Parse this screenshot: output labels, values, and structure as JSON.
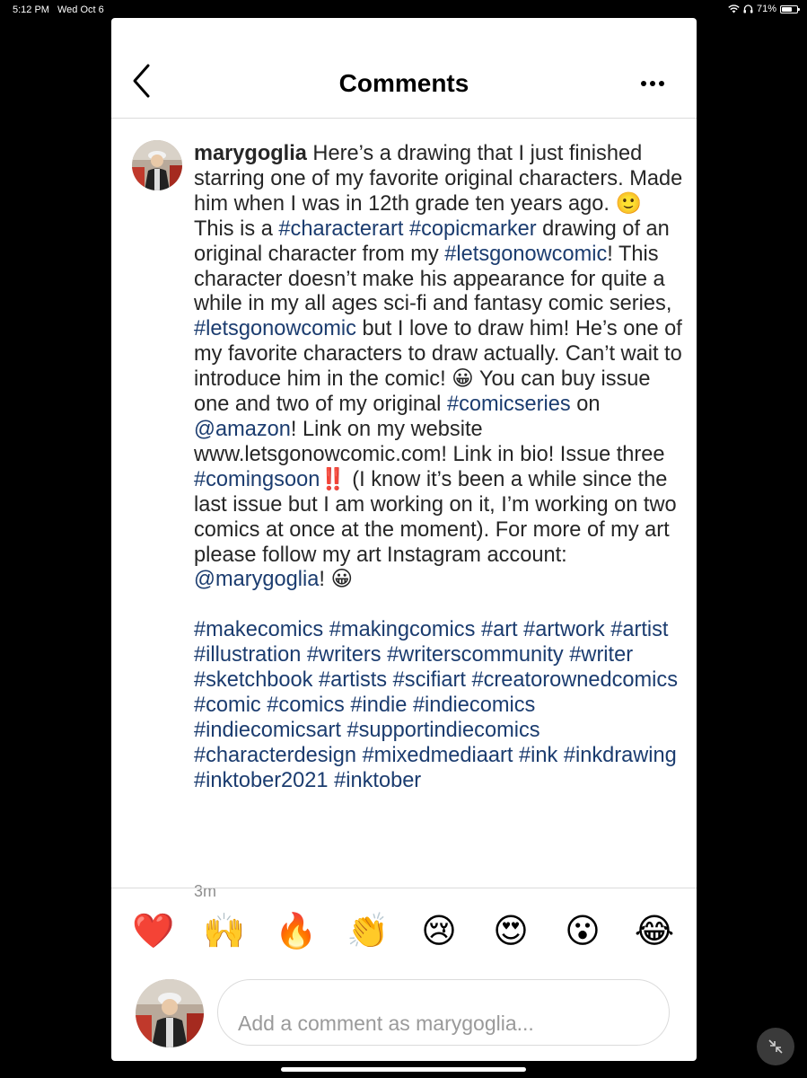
{
  "status": {
    "time": "5:12 PM",
    "date": "Wed Oct 6",
    "battery": "71%",
    "battery_level": 0.71
  },
  "header": {
    "title": "Comments"
  },
  "caption": {
    "username": "marygoglia",
    "p1": [
      {
        "t": "text",
        "v": " Here’s a drawing that I just finished starring one of my favorite original characters. Made him when I was in 12th grade ten years ago. 🙂 This is a "
      },
      {
        "t": "tag",
        "v": "#characterart"
      },
      {
        "t": "text",
        "v": " "
      },
      {
        "t": "tag",
        "v": "#copicmarker"
      },
      {
        "t": "text",
        "v": " drawing of an original character from my "
      },
      {
        "t": "tag",
        "v": "#letsgonowcomic"
      },
      {
        "t": "text",
        "v": "! This character doesn’t make his appearance for quite a while in my all ages sci-fi and fantasy comic series, "
      },
      {
        "t": "tag",
        "v": "#letsgonowcomic"
      },
      {
        "t": "text",
        "v": " but I love to draw him! He’s one of my favorite characters to draw actually. Can’t wait to introduce him in the comic! 😀 You can buy issue one and two of my original "
      },
      {
        "t": "tag",
        "v": "#comicseries"
      },
      {
        "t": "text",
        "v": " on "
      },
      {
        "t": "mention",
        "v": "@amazon"
      },
      {
        "t": "text",
        "v": "! Link on my website www.letsgonowcomic.com! Link in bio! Issue three "
      },
      {
        "t": "tag",
        "v": "#comingsoon"
      },
      {
        "t": "text",
        "v": "‼️ (I know it’s been a while since the last issue but I am working on it, I’m working on two comics at once at the moment). For more of my art please follow my art Instagram account: "
      },
      {
        "t": "mention",
        "v": "@marygoglia"
      },
      {
        "t": "text",
        "v": "! 😀"
      }
    ],
    "hashtags": [
      "#makecomics",
      "#makingcomics",
      "#art",
      "#artwork",
      "#artist",
      "#illustration",
      "#writers",
      "#writerscommunity",
      "#writer",
      "#sketchbook",
      "#artists",
      "#scifiart",
      "#creatorownedcomics",
      "#comic",
      "#comics",
      "#indie",
      "#indiecomics",
      "#indiecomicsart",
      "#supportindiecomics",
      "#characterdesign",
      "#mixedmediaart",
      "#ink",
      "#inkdrawing",
      "#inktober2021",
      "#inktober"
    ],
    "time_ago": "3m"
  },
  "reactions": [
    "❤️",
    "🙌",
    "🔥",
    "👏",
    "😢",
    "😍",
    "😮",
    "😂"
  ],
  "comment_box": {
    "placeholder": "Add a comment as marygoglia..."
  },
  "icons": {
    "back": "chevron-left-icon",
    "more": "more-horizontal-icon",
    "wifi": "wifi-icon",
    "headphones": "headphones-icon",
    "battery": "battery-icon",
    "collapse": "collapse-arrows-icon"
  },
  "colors": {
    "link": "#1b3c6f",
    "text": "#262626",
    "muted": "#8e8e8e"
  }
}
